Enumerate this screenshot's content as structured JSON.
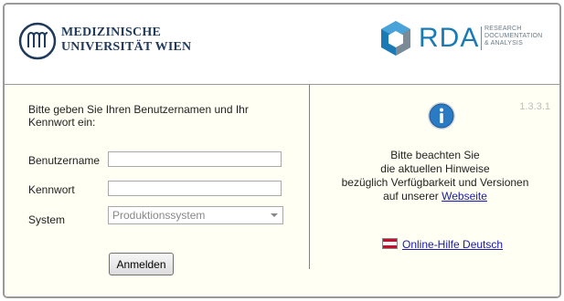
{
  "header": {
    "institution_line1": "MEDIZINISCHE",
    "institution_line2": "UNIVERSITÄT WIEN",
    "rda_name": "RDA",
    "rda_sub_line1": "RESEARCH",
    "rda_sub_line2": "DOCUMENTATION",
    "rda_sub_line3": "& ANALYSIS",
    "brand_color": "#1a7ab5"
  },
  "login": {
    "instructions": "Bitte geben Sie Ihren Benutzernamen und Ihr Kennwort ein:",
    "username_label": "Benutzername",
    "username_value": "",
    "password_label": "Kennwort",
    "password_value": "",
    "system_label": "System",
    "system_selected": "Produktionssystem",
    "submit_label": "Anmelden"
  },
  "info": {
    "version": "1.3.3.1",
    "line1": "Bitte beachten Sie",
    "line2": "die aktuellen Hinweise",
    "line3": "bezüglich Verfügbarkeit und Versionen",
    "line4_prefix": "auf unserer",
    "website_link": "Webseite",
    "help_link": "Online-Hilfe Deutsch",
    "icon": "info-icon",
    "flag_icon": "austria-flag-icon"
  },
  "colors": {
    "content_bg": "#fffff3",
    "link": "#1a1aa6",
    "info_icon": "#2b7bc4"
  }
}
